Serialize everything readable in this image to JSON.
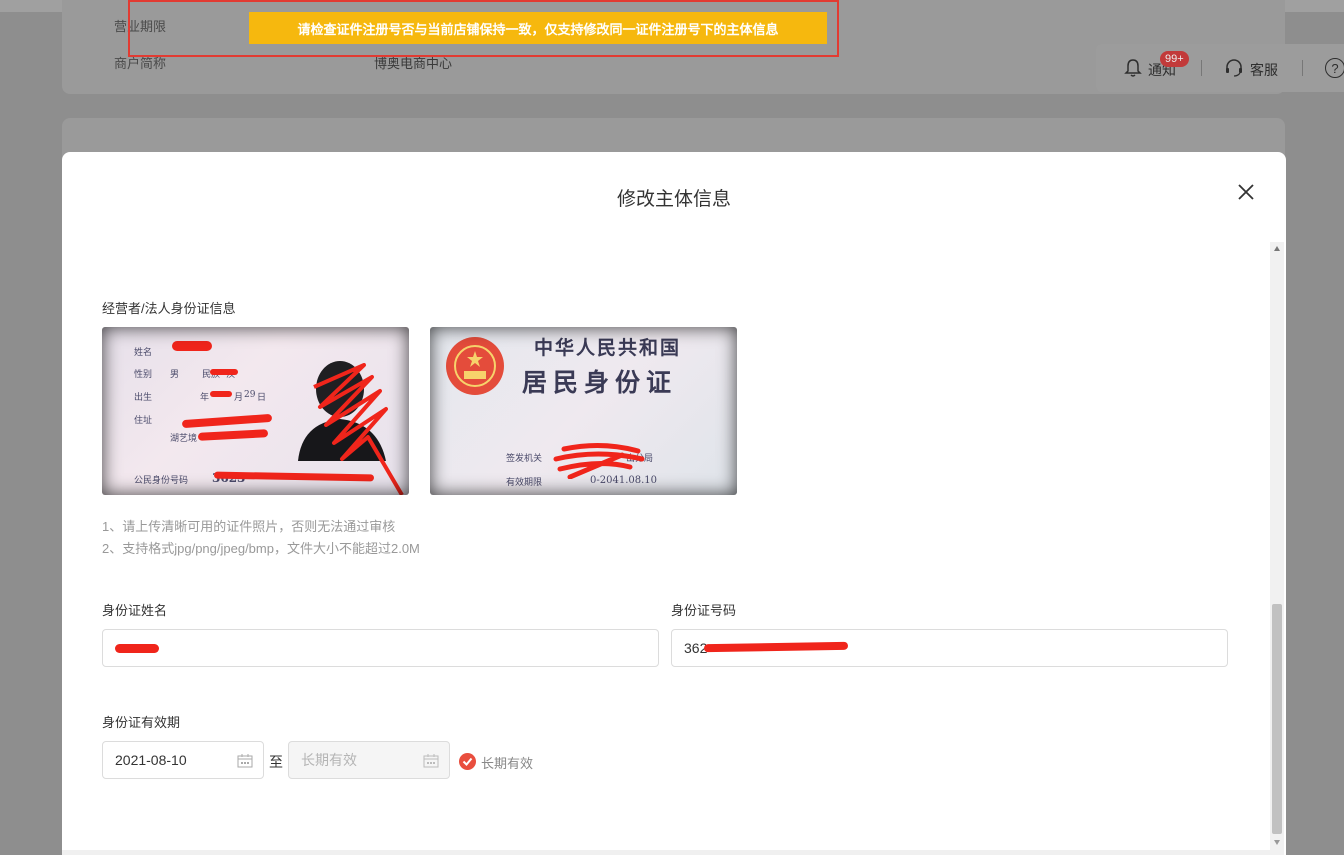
{
  "background": {
    "fields": [
      {
        "label": "营业期限",
        "value": ""
      },
      {
        "label": "商户简称",
        "value": "博奥电商中心"
      }
    ],
    "header": {
      "notification_label": "通知",
      "notification_badge": "99+",
      "service_label": "客服",
      "help_symbol": "?"
    }
  },
  "toast": {
    "message": "请检查证件注册号否与当前店铺保持一致，仅支持修改同一证件注册号下的主体信息"
  },
  "modal": {
    "title": "修改主体信息",
    "section_title": "经营者/法人身份证信息",
    "id_front": {
      "fields": [
        "姓名",
        "性别",
        "男",
        "民族",
        "汉",
        "出生",
        "年",
        "月",
        "29",
        "日",
        "住址",
        "湖艺境",
        "公民身份号码",
        "3623"
      ]
    },
    "id_back": {
      "heading_1": "中华人民共和国",
      "heading_2": "居民身份证",
      "issuer_label": "签发机关",
      "issuer_suffix": "山分局",
      "validity_label": "有效期限",
      "validity_value": "0-2041.08.10"
    },
    "hints": [
      "1、请上传清晰可用的证件照片，否则无法通过审核",
      "2、支持格式jpg/png/jpeg/bmp，文件大小不能超过2.0M"
    ],
    "form": {
      "name_label": "身份证姓名",
      "name_value": "",
      "number_label": "身份证号码",
      "number_value": "362",
      "validity_label": "身份证有效期",
      "start_date": "2021-08-10",
      "to_label": "至",
      "end_placeholder": "长期有效",
      "long_term_label": "长期有效",
      "long_term_checked": true
    }
  },
  "colors": {
    "accent_red": "#e94e3e",
    "toast_bg": "#f6b80e",
    "highlight_border": "#e23b32"
  }
}
